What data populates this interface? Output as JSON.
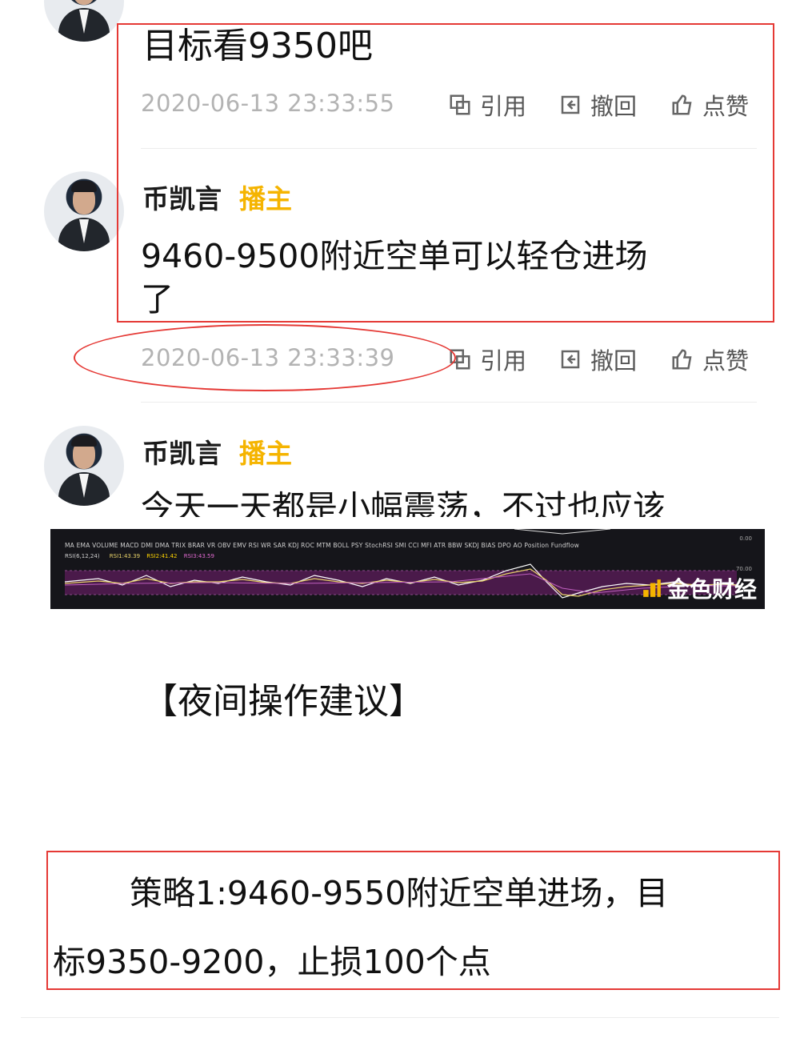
{
  "posts": [
    {
      "message": "目标看9350吧",
      "timestamp": "2020-06-13 23:33:55",
      "actions": {
        "quote": "引用",
        "recall": "撤回",
        "like": "点赞"
      }
    },
    {
      "author": "币凯言",
      "role": "播主",
      "message_line1": "9460-9500附近空单可以轻仓进场",
      "message_line2": "了",
      "timestamp": "2020-06-13 23:33:39",
      "actions": {
        "quote": "引用",
        "recall": "撤回",
        "like": "点赞"
      }
    },
    {
      "author": "币凯言",
      "role": "播主",
      "message_partial": "今天一天都是小幅震荡，不过也应该"
    }
  ],
  "chart": {
    "indicators": "MA  EMA  VOLUME  MACD  DMI  DMA  TRIX  BRAR  VR  OBV  EMV  RSI  WR  SAR  KDJ  ROC  MTM  BOLL  PSY  StochRSI  SMI  CCI  MFI  ATR  BBW  SKDJ  BIAS  DPO  AO  Position  Fundflow",
    "legend_label": "RSI(6,12,24)",
    "rsi1": "RSI1:43.39",
    "rsi2": "RSI2:41.42",
    "rsi3": "RSI3:43.59",
    "axis_top": "0.00",
    "axis_mid": "70.00",
    "watermark": "金色财经"
  },
  "article": {
    "heading": "【夜间操作建议】",
    "strategy_line1": "策略1:9460-9550附近空单进场，目",
    "strategy_line2": "标9350-9200，止损100个点"
  },
  "colors": {
    "role": "#f5b400",
    "highlight_box": "#e53935",
    "timestamp": "#b3b3b3"
  }
}
